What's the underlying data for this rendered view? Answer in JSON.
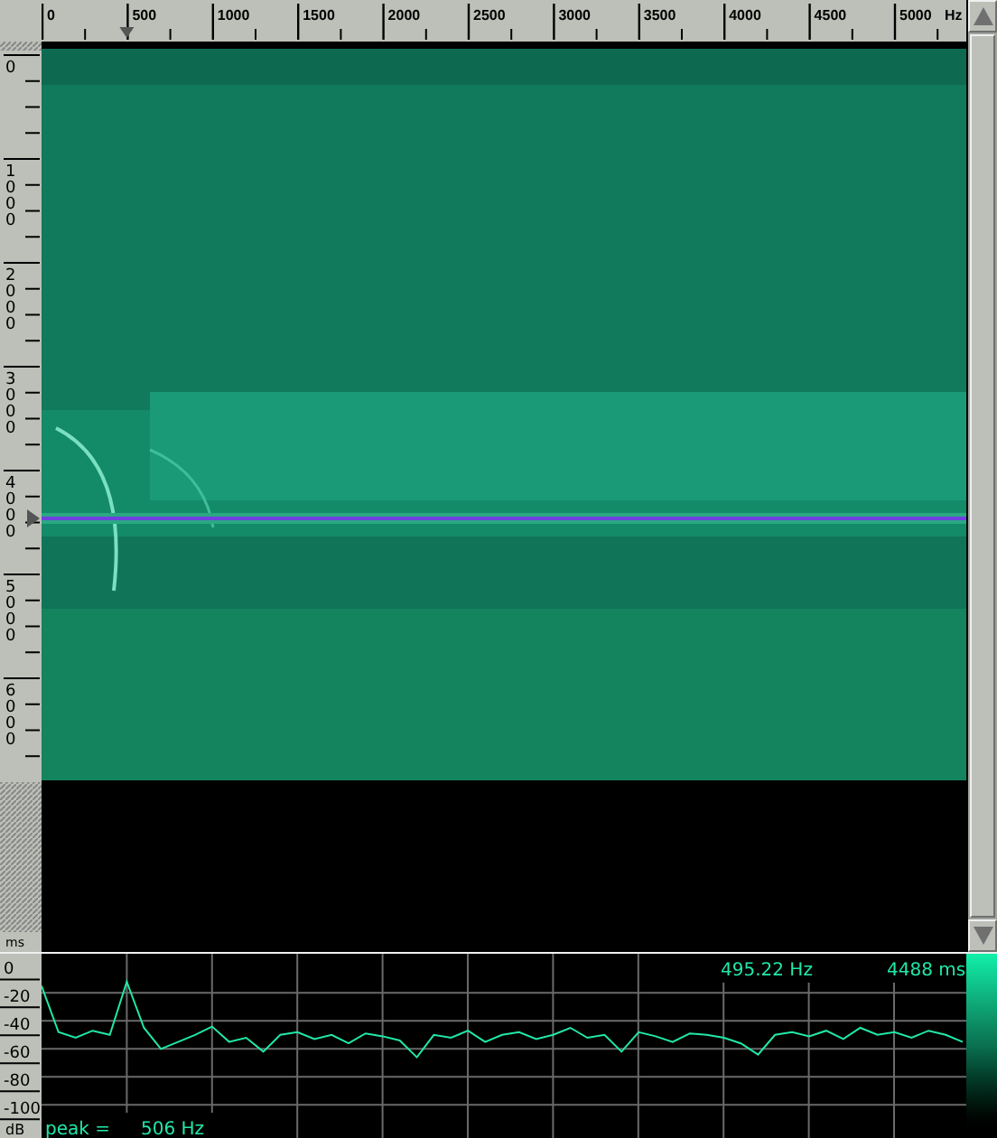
{
  "frequency_ruler": {
    "labels": [
      "0",
      "500",
      "1000",
      "1500",
      "2000",
      "2500",
      "3000",
      "3500",
      "4000",
      "4500",
      "5000"
    ],
    "unit": "Hz"
  },
  "time_ruler": {
    "labels": [
      "0",
      "1000",
      "2000",
      "3000",
      "4000",
      "5000",
      "6000"
    ],
    "unit": "ms"
  },
  "spectrum": {
    "chart_data": {
      "type": "line",
      "ylabel": "dB",
      "yticks": [
        0,
        -20,
        -40,
        -60,
        -80,
        -100
      ],
      "ylim": [
        -125,
        8
      ],
      "grid": true,
      "series": [
        {
          "color": "#20e8a8",
          "values": [
            -15,
            -48,
            -52,
            -47,
            -50,
            -12,
            -45,
            -60,
            -55,
            -50,
            -44,
            -55,
            -52,
            -62,
            -50,
            -48,
            -53,
            -50,
            -56,
            -49,
            -51,
            -54,
            -66,
            -50,
            -52,
            -47,
            -55,
            -50,
            -48,
            -53,
            -50,
            -45,
            -52,
            -50,
            -62,
            -48,
            -51,
            -55,
            -49,
            -50,
            -52,
            -56,
            -64,
            -50,
            -48,
            -51,
            -47,
            -53,
            -45,
            -50,
            -48,
            -52,
            -47,
            -50,
            -55
          ]
        }
      ]
    }
  },
  "readout": {
    "frequency": "495.22 Hz",
    "time": "4488 ms"
  },
  "peak": {
    "label": "peak =",
    "value": "506 Hz"
  }
}
